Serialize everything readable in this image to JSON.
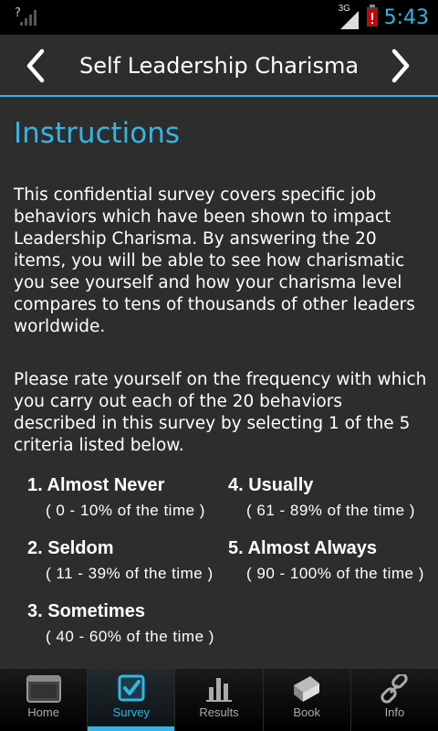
{
  "status_bar": {
    "network_label": "3G",
    "time": "5:43"
  },
  "header": {
    "title": "Self Leadership Charisma",
    "prev_icon": "chevron-left-icon",
    "next_icon": "chevron-right-icon"
  },
  "content": {
    "title": "Instructions",
    "paragraph1": "This confidential survey covers specific job behaviors which have been shown to impact Leadership Charisma. By answering the 20 items, you will be able to see how charismatic you see yourself and how your charisma level compares to tens of thousands of other leaders worldwide.",
    "paragraph2": "Please rate yourself on the frequency with which you carry out each of the 20 behaviors described in this survey by selecting 1 of the 5 criteria listed below.",
    "criteria": [
      {
        "label": "1. Almost Never",
        "range": "( 0 - 10% of the time )"
      },
      {
        "label": "2. Seldom",
        "range": "( 11 - 39% of the time )"
      },
      {
        "label": "3. Sometimes",
        "range": "( 40 - 60% of the time )"
      },
      {
        "label": "4. Usually",
        "range": "( 61 - 89% of the time )"
      },
      {
        "label": "5. Almost Always",
        "range": "( 90 - 100% of the time )"
      }
    ]
  },
  "tabs": [
    {
      "label": "Home",
      "icon": "home-window-icon"
    },
    {
      "label": "Survey",
      "icon": "checkbox-icon",
      "active": true
    },
    {
      "label": "Results",
      "icon": "bar-chart-icon"
    },
    {
      "label": "Book",
      "icon": "book-icon"
    },
    {
      "label": "Info",
      "icon": "link-icon"
    }
  ],
  "colors": {
    "accent": "#33b5e5",
    "background": "#2d2d2d",
    "battery": "#cc0000"
  }
}
